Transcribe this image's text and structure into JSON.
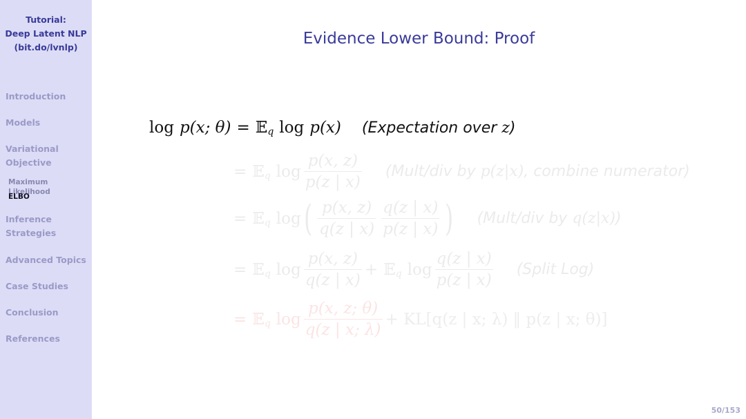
{
  "sidebar": {
    "title_lines": [
      "Tutorial:",
      "Deep Latent NLP",
      "(bit.do/lvnlp)"
    ],
    "items": [
      {
        "label": "Introduction"
      },
      {
        "label": "Models"
      },
      {
        "label_lines": [
          "Variational",
          "Objective"
        ],
        "subitems": [
          {
            "label": "Maximum Likelihood",
            "active": false
          },
          {
            "label": "ELBO",
            "active": true
          }
        ]
      },
      {
        "label_lines": [
          "Inference",
          "Strategies"
        ]
      },
      {
        "label": "Advanced Topics"
      },
      {
        "label": "Case Studies"
      },
      {
        "label": "Conclusion"
      },
      {
        "label": "References"
      }
    ]
  },
  "slide": {
    "title": "Evidence Lower Bound: Proof",
    "equations": [
      {
        "lhs": "log p(x; θ)",
        "rhs": "= 𝔼q log p(x)",
        "note": "(Expectation over z)",
        "state": "visible"
      },
      {
        "rhs": "= 𝔼q log p(x, z) / p(z | x)",
        "note": "(Mult/div by p(z|x), combine numerator)",
        "state": "faded"
      },
      {
        "rhs": "= 𝔼q log ( p(x, z)/q(z | x) · q(z | x)/p(z | x) )",
        "note": "(Mult/div by q(z|x))",
        "state": "faded"
      },
      {
        "rhs": "= 𝔼q log p(x, z)/q(z | x) + 𝔼q log q(z | x)/p(z | x)",
        "note": "(Split Log)",
        "state": "faded"
      },
      {
        "rhs": "= 𝔼q log p(x, z; θ)/q(z | x; λ) + KL[q(z | x; λ) ‖ p(z | x; θ)]",
        "state": "faded-highlight"
      }
    ],
    "notes": {
      "n1_a": "(Expectation over ",
      "n1_var": "z",
      "n1_b": ")",
      "n2_a": "(Mult/div by ",
      "n2_m": "p(z|x)",
      "n2_b": ", combine numerator)",
      "n3_a": "(Mult/div by ",
      "n3_m": "q(z|x)",
      "n3_b": ")",
      "n4": "(Split Log)"
    },
    "math": {
      "log": "log",
      "p": "p",
      "q": "q",
      "E": "𝔼",
      "eq": "=",
      "plus": "+",
      "lhs_args": "(x; θ)",
      "px": "(x)",
      "pxz": "(x, z)",
      "pzx": "(z | x)",
      "pxz_theta": "(x, z; θ)",
      "qzx_lambda": "(z | x; λ)",
      "kl": "KL[q(z | x; λ) ‖ p(z | x; θ)]",
      "lparen": "(",
      "rparen": ")"
    }
  },
  "footer": {
    "page": "50/153"
  },
  "colors": {
    "sidebar_bg": "#dcdcf6",
    "title": "#3a3a9a",
    "faded": "#ebebeb",
    "highlight_faded": "#fbe4e4"
  }
}
